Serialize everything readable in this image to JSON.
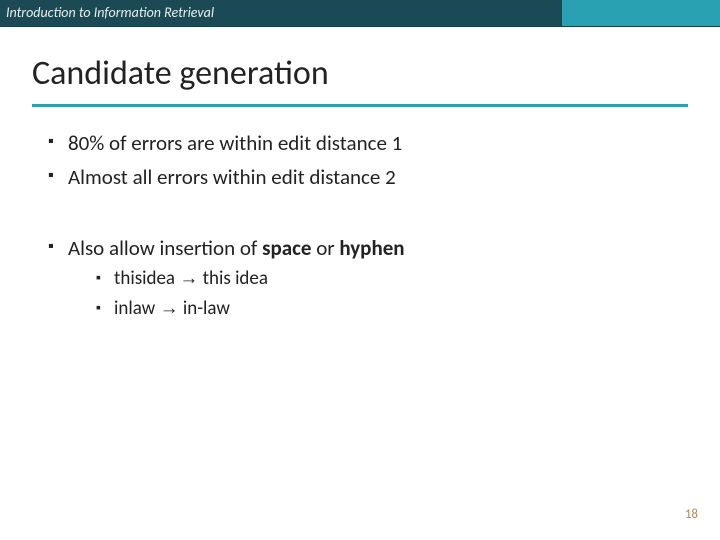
{
  "header": {
    "course": "Introduction to Information Retrieval"
  },
  "title": "Candidate generation",
  "bullets": {
    "b1": "80% of errors are within edit distance 1",
    "b2": "Almost all errors within edit distance 2",
    "b3_pre": "Also allow insertion of ",
    "b3_space": "space",
    "b3_or": " or ",
    "b3_hyphen": "hyphen",
    "sub1_src": "thisidea",
    "arrow": "→",
    "sub1_dst": "  this idea",
    "sub2_src": "inlaw",
    "sub2_dst": " in-law"
  },
  "page_number": "18"
}
